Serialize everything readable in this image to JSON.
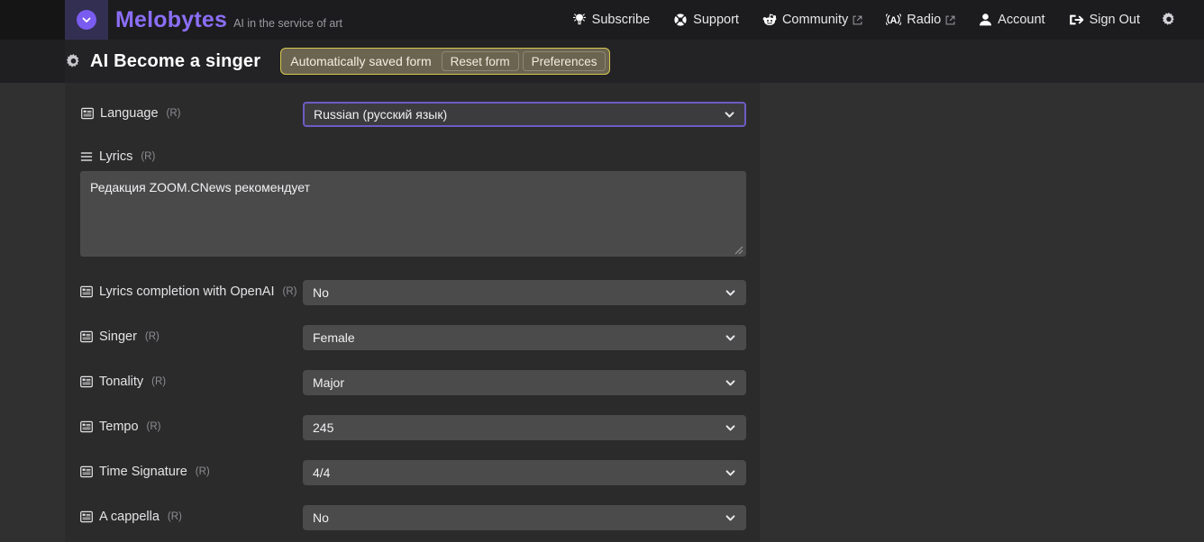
{
  "brand": {
    "name": "Melobytes",
    "tagline": "AI in the service of art",
    "logo_icon": "chevron-circle-down-icon"
  },
  "navbar": {
    "items": [
      {
        "label": "Subscribe",
        "icon": "lightbulb-icon",
        "external": false
      },
      {
        "label": "Support",
        "icon": "life-ring-icon",
        "external": false
      },
      {
        "label": "Community",
        "icon": "reddit-icon",
        "external": true
      },
      {
        "label": "Radio",
        "icon": "broadcast-tower-icon",
        "external": true
      },
      {
        "label": "Account",
        "icon": "user-icon",
        "external": false
      },
      {
        "label": "Sign Out",
        "icon": "sign-out-icon",
        "external": false
      }
    ],
    "settings_icon": "gear-icon"
  },
  "titlebar": {
    "icon": "gear-icon",
    "title": "AI Become a singer",
    "banner": {
      "message": "Automatically saved form",
      "reset_label": "Reset form",
      "preferences_label": "Preferences",
      "border_color": "#d6c84e",
      "background_color": "#6b6450"
    }
  },
  "form": {
    "required_mark": "(R)",
    "fields": [
      {
        "label": "Language",
        "icon": "list-box-icon",
        "type": "select",
        "value": "Russian (русский язык)",
        "focused": true
      },
      {
        "label": "Lyrics",
        "icon": "bars-icon",
        "type": "textarea",
        "value": "Редакция ZOOM.CNews рекомендует"
      },
      {
        "label": "Lyrics completion with OpenAI",
        "icon": "list-box-icon",
        "type": "select",
        "value": "No",
        "focused": false
      },
      {
        "label": "Singer",
        "icon": "list-box-icon",
        "type": "select",
        "value": "Female",
        "focused": false
      },
      {
        "label": "Tonality",
        "icon": "list-box-icon",
        "type": "select",
        "value": "Major",
        "focused": false
      },
      {
        "label": "Tempo",
        "icon": "list-box-icon",
        "type": "select",
        "value": "245",
        "focused": false
      },
      {
        "label": "Time Signature",
        "icon": "list-box-icon",
        "type": "select",
        "value": "4/4",
        "focused": false
      },
      {
        "label": "A cappella",
        "icon": "list-box-icon",
        "type": "select",
        "value": "No",
        "focused": false
      }
    ]
  },
  "colors": {
    "accent": "#8b6ef5",
    "focus_border": "#6c5cc4",
    "nav_bg": "#1c1c1e",
    "panel_bg": "#2b2b2c",
    "page_bg": "#303031",
    "select_bg": "#4b4b4c"
  }
}
